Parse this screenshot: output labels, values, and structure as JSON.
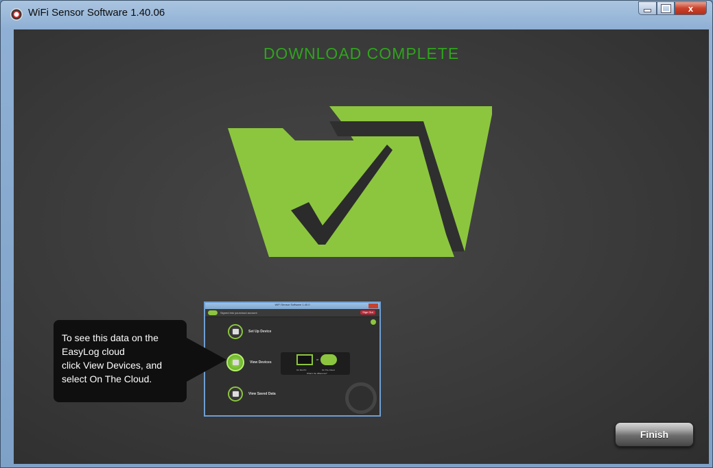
{
  "window": {
    "title": "WiFi Sensor Software 1.40.06",
    "controls": {
      "minimize": "minimize",
      "maximize": "maximize",
      "close": "x"
    }
  },
  "main": {
    "headline": "DOWNLOAD COMPLETE",
    "graphic_icon": "folder-checkmark-icon",
    "accent_color": "#8cc63f",
    "headline_color": "#2fa41d"
  },
  "thumbnail": {
    "title": "WiFi Sensor Software 1.40.0",
    "signed_in": "Signed into yourcloud account",
    "sign_out": "Sign Out",
    "items": [
      {
        "label": "Set Up Device",
        "icon": "setup-icon"
      },
      {
        "label": "View Devices",
        "icon": "devices-icon"
      },
      {
        "label": "View Saved Data",
        "icon": "folder-icon"
      }
    ],
    "choice_pc": "On this PC",
    "choice_or": "or",
    "choice_cloud": "On The Cloud",
    "choice_link": "What's the difference?",
    "badge": "WiFi"
  },
  "callout": {
    "lines": [
      "To see this data on the",
      "EasyLog cloud",
      "click View Devices, and",
      "select On The Cloud."
    ]
  },
  "footer": {
    "finish_label": "Finish"
  }
}
